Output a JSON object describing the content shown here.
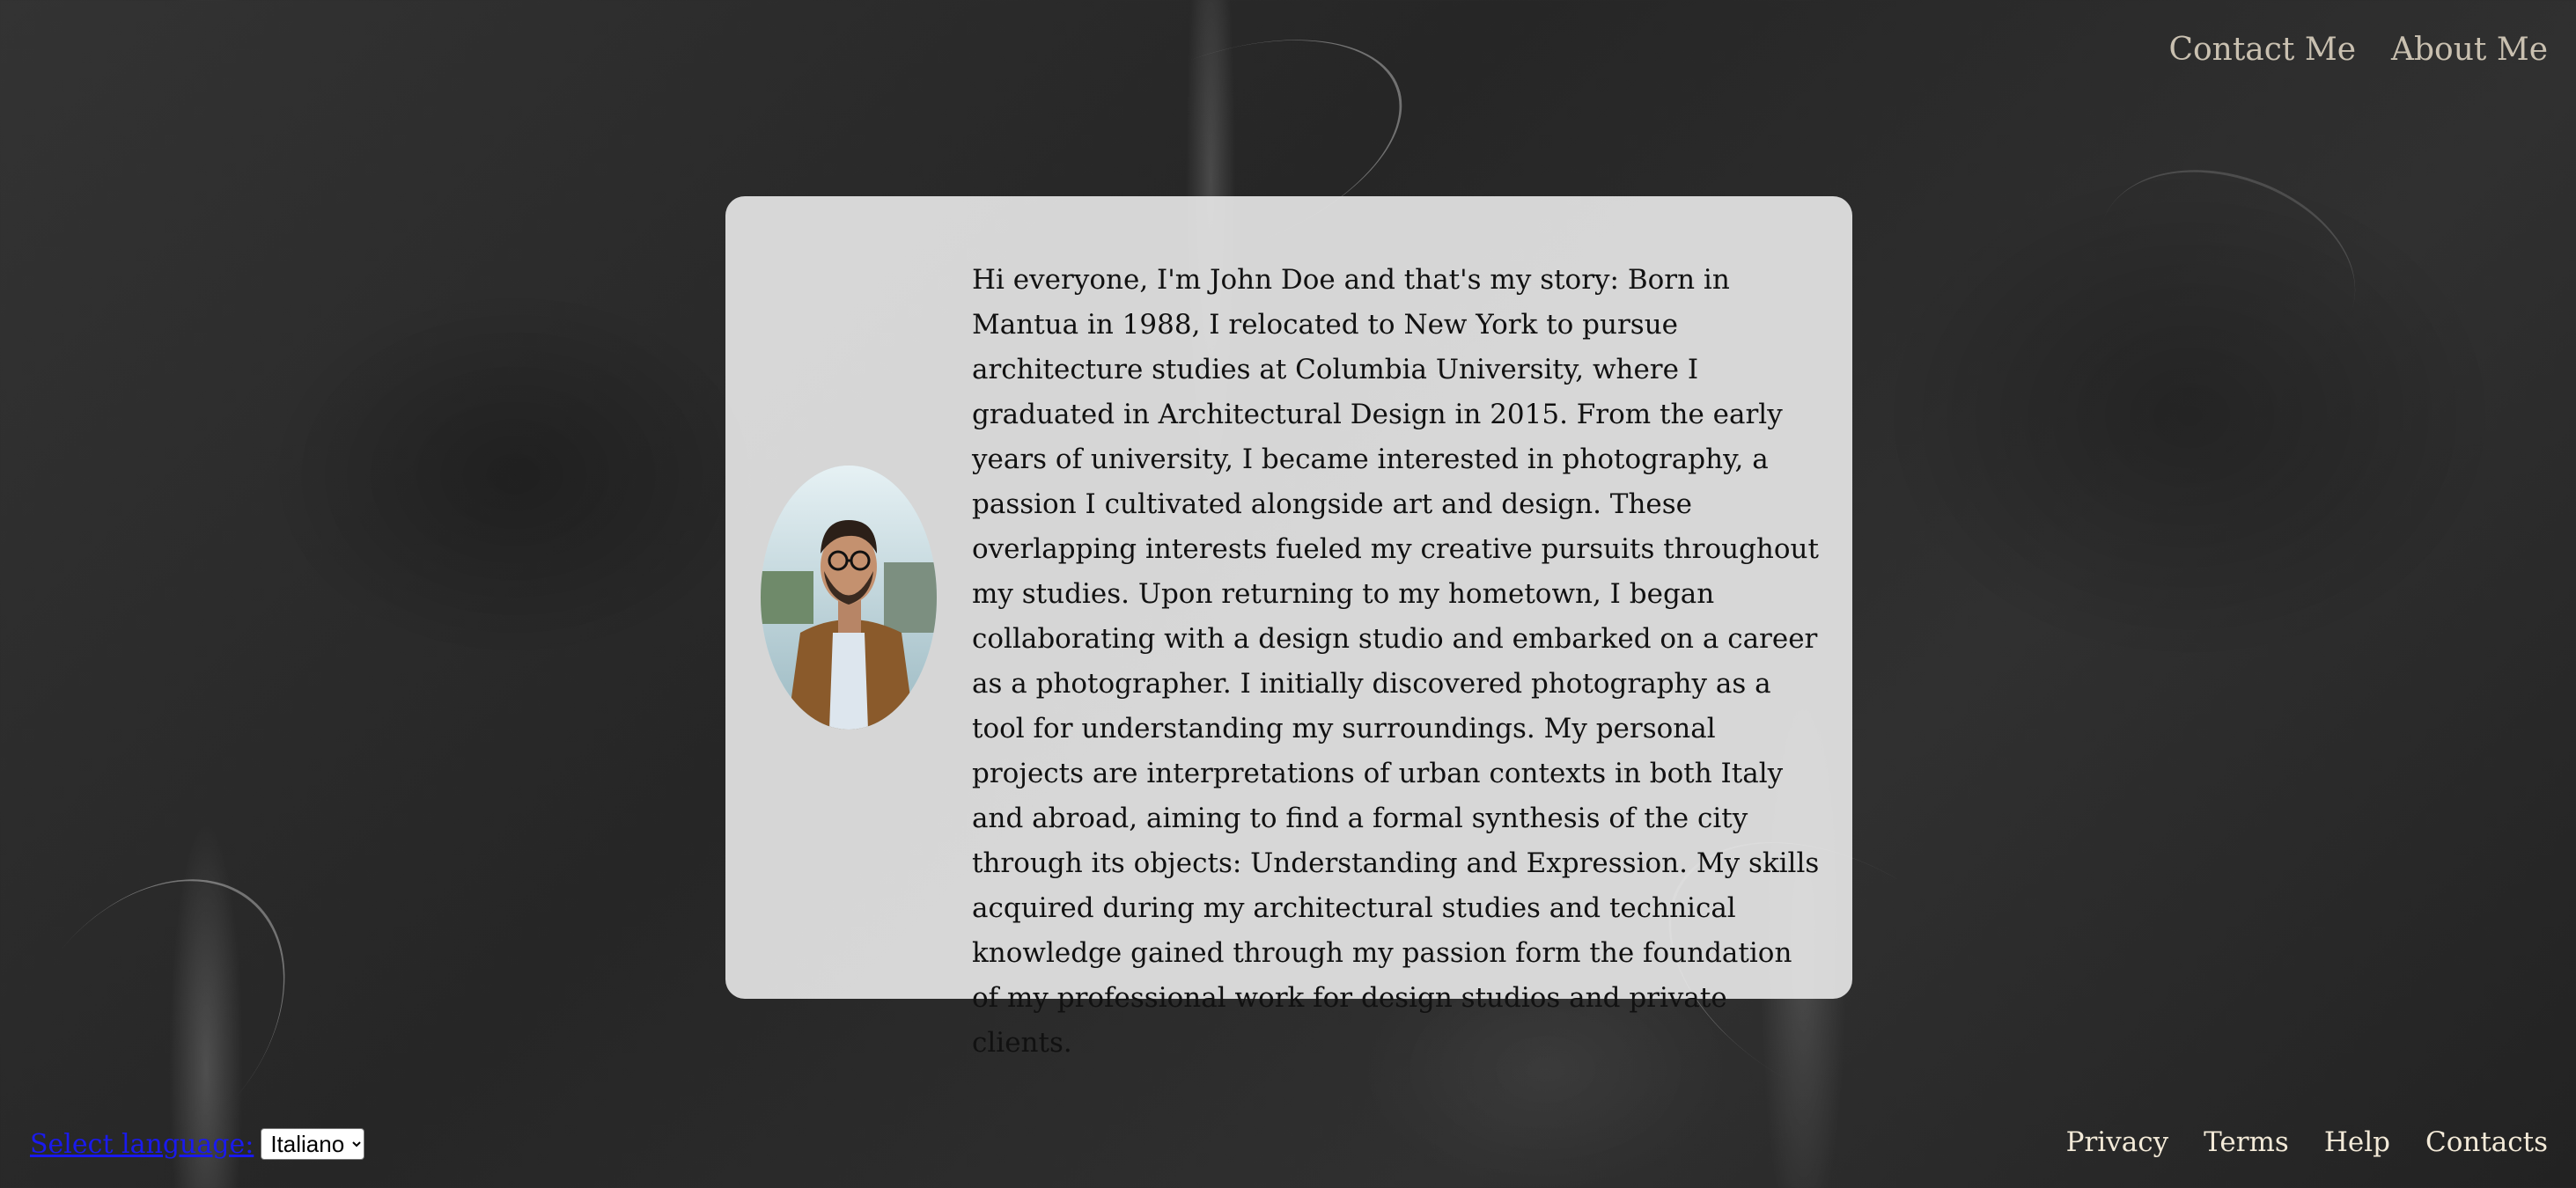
{
  "header": {
    "nav": [
      {
        "label": "Contact Me"
      },
      {
        "label": "About Me"
      }
    ]
  },
  "profile": {
    "photo_icon": "portrait-photo",
    "bio": "Hi everyone, I'm John Doe and that's my story: Born in Mantua in 1988, I relocated to New York to pursue architecture studies at Columbia University, where I graduated in Architectural Design in 2015. From the early years of university, I became interested in photography, a passion I cultivated alongside art and design. These overlapping interests fueled my creative pursuits throughout my studies. Upon returning to my hometown, I began collaborating with a design studio and embarked on a career as a photographer. I initially discovered photography as a tool for understanding my surroundings. My personal projects are interpretations of urban contexts in both Italy and abroad, aiming to find a formal synthesis of the city through its objects: Understanding and Expression. My skills acquired during my architectural studies and technical knowledge gained through my passion form the foundation of my professional work for design studios and private clients."
  },
  "footer": {
    "language_label": "Select language:",
    "language_selected": "Italiano",
    "links": [
      {
        "label": "Privacy"
      },
      {
        "label": "Terms"
      },
      {
        "label": "Help"
      },
      {
        "label": "Contacts"
      }
    ]
  },
  "colors": {
    "background": "#2b2b2b",
    "card": "#e4e4e4",
    "nav_text": "#c9c0b0",
    "footer_text": "#f3ead8",
    "link_blue": "#1a1aee"
  }
}
